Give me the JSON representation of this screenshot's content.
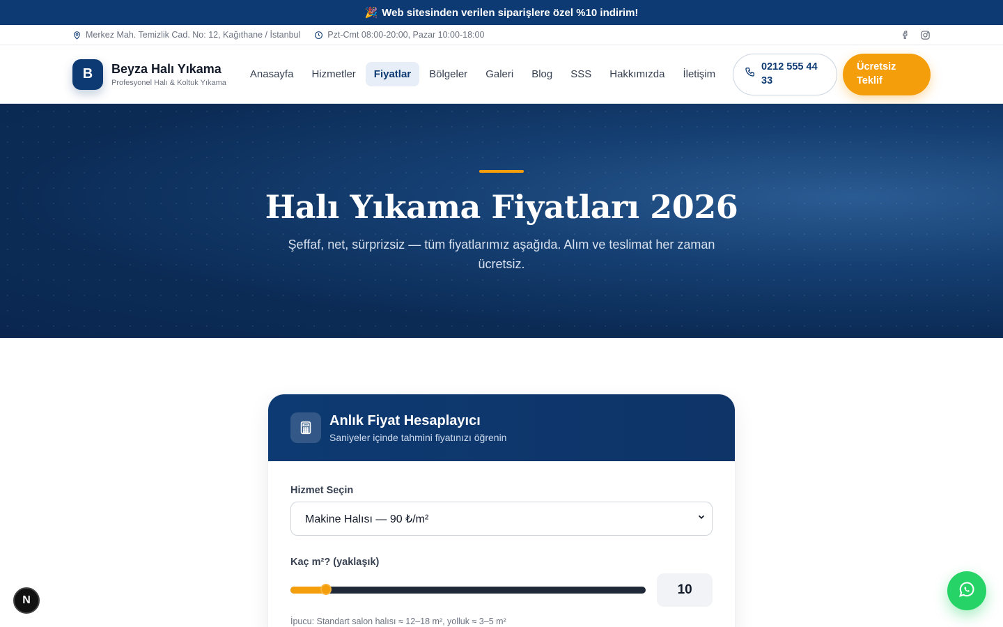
{
  "promo": {
    "emoji": "🎉",
    "text": "Web sitesinden verilen siparişlere özel %10 indirim!"
  },
  "topbar": {
    "address": "Merkez Mah. Temizlik Cad. No: 12, Kağıthane / İstanbul",
    "hours": "Pzt-Cmt 08:00-20:00, Pazar 10:00-18:00",
    "socials": [
      "facebook-icon",
      "instagram-icon"
    ]
  },
  "header": {
    "logo_letter": "B",
    "brand": "Beyza Halı Yıkama",
    "tagline": "Profesyonel Halı & Koltuk Yıkama",
    "nav": [
      {
        "label": "Anasayfa",
        "active": false
      },
      {
        "label": "Hizmetler",
        "active": false
      },
      {
        "label": "Fiyatlar",
        "active": true
      },
      {
        "label": "Bölgeler",
        "active": false
      },
      {
        "label": "Galeri",
        "active": false
      },
      {
        "label": "Blog",
        "active": false
      },
      {
        "label": "SSS",
        "active": false
      },
      {
        "label": "Hakkımızda",
        "active": false
      },
      {
        "label": "İletişim",
        "active": false
      }
    ],
    "phone": "0212 555 44 33",
    "quote_label": "Ücretsiz Teklif"
  },
  "hero": {
    "title": "Halı Yıkama Fiyatları 2026",
    "subtitle": "Şeffaf, net, sürprizsiz — tüm fiyatlarımız aşağıda. Alım ve teslimat her zaman ücretsiz."
  },
  "calculator": {
    "title": "Anlık Fiyat Hesaplayıcı",
    "subtitle": "Saniyeler içinde tahmini fiyatınızı öğrenin",
    "service_label": "Hizmet Seçin",
    "service_selected": "Makine Halısı — 90 ₺/m²",
    "m2_label": "Kaç m²? (yaklaşık)",
    "m2_value": "10",
    "m2_fraction": 0.1,
    "tip": "İpucu: Standart salon halısı ≈ 12–18 m², yolluk ≈ 3–5 m²"
  },
  "colors": {
    "primary": "#0d3a72",
    "accent": "#f59e0b",
    "whatsapp": "#25d366"
  },
  "floating": {
    "whatsapp": "whatsapp-icon",
    "next_badge": "N"
  }
}
